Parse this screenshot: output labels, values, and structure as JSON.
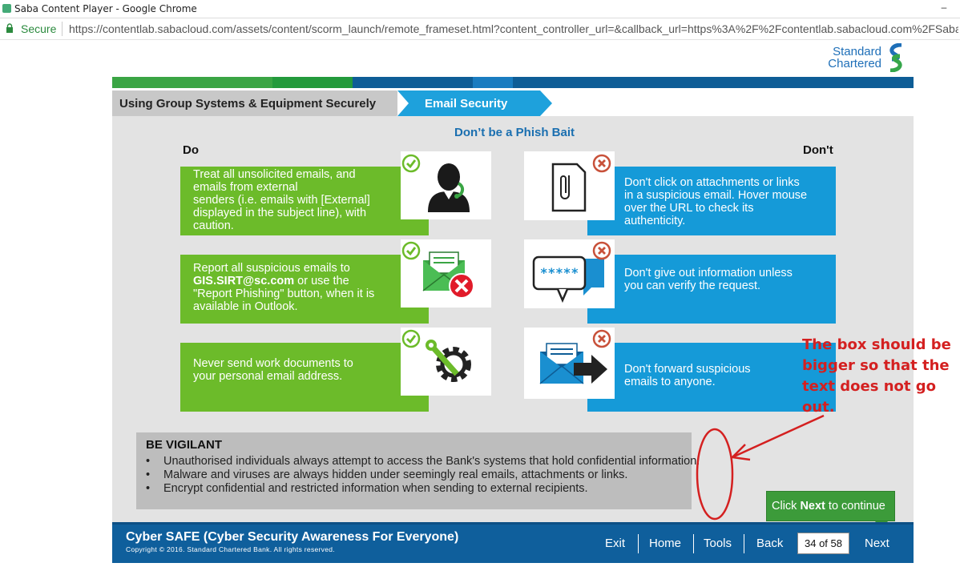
{
  "browser": {
    "window_title": "Saba Content Player - Google Chrome",
    "secure_label": "Secure",
    "url": "https://contentlab.sabacloud.com/assets/content/scorm_launch/remote_frameset.html?content_controller_url=&callback_url=https%3A%2F%2Fcontentlab.sabacloud.com%2FSaba%"
  },
  "logo": {
    "line1": "Standard",
    "line2": "Chartered"
  },
  "breadcrumb": {
    "section": "Using Group Systems & Equipment Securely",
    "topic": "Email Security"
  },
  "slide": {
    "title": "Don’t be a Phish Bait",
    "do_label": "Do",
    "dont_label": "Don't",
    "do_items": [
      {
        "lines": [
          "Treat all unsolicited emails, and",
          "emails from external",
          "senders (i.e. emails with [External]",
          "displayed in the subject line), with",
          "caution."
        ],
        "icon": "support-agent-icon"
      },
      {
        "line1": "Report all suspicious emails to",
        "email": "GIS.SIRT@sc.com",
        "line2_rest": " or use the",
        "lines": [
          "\"Report Phishing\" button, when it is",
          "available in Outlook."
        ],
        "icon": "reject-email-icon"
      },
      {
        "lines": [
          "Never send work documents to",
          "your personal email address."
        ],
        "icon": "settings-tools-icon"
      }
    ],
    "dont_items": [
      {
        "lines": [
          "Don't click on attachments or links",
          "in a suspicious email. Hover mouse",
          "over the URL to check its",
          "authenticity."
        ],
        "icon": "attachment-document-icon"
      },
      {
        "lines": [
          "Don't give out information unless",
          "you can verify the request."
        ],
        "icon": "password-chat-icon"
      },
      {
        "lines": [
          "Don't forward suspicious",
          "emails to anyone."
        ],
        "icon": "forward-email-icon"
      }
    ]
  },
  "vigilant": {
    "title": "BE VIGILANT",
    "items": [
      "Unauthorised individuals always attempt to access the Bank's systems that hold confidential information.",
      "Malware and viruses are always hidden under seemingly real emails, attachments or links.",
      "Encrypt confidential and restricted information when sending to external recipients."
    ]
  },
  "footer": {
    "title": "Cyber SAFE (Cyber Security Awareness For Everyone)",
    "copyright": "Copyright © 2016. Standard Chartered Bank. All rights reserved.",
    "nav": {
      "exit": "Exit",
      "home": "Home",
      "tools": "Tools",
      "back": "Back",
      "next": "Next"
    },
    "page_indicator": "34 of 58"
  },
  "tooltip": {
    "prefix": "Click ",
    "bold": "Next",
    "suffix": " to continue"
  },
  "annotation": {
    "note": "The box should be bigger so that the text does not go out."
  },
  "colors": {
    "green": "#6cbb2a",
    "blue": "#159ad8",
    "footer_blue": "#0f5f9c",
    "annotation_red": "#d42020"
  }
}
